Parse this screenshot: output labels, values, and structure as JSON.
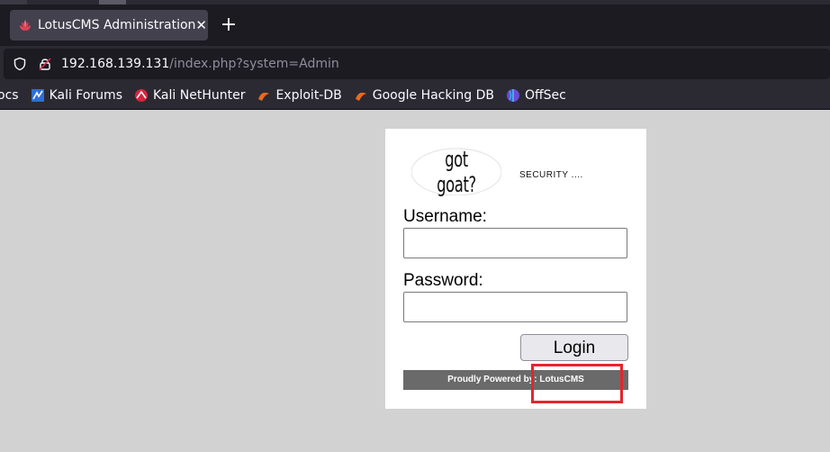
{
  "browser": {
    "tab": {
      "title": "LotusCMS Administration",
      "favicon": "lotus-icon",
      "close_glyph": "✕"
    },
    "new_tab_glyph": "+",
    "url": {
      "host": "192.168.139.131",
      "path": "/index.php?system=Admin"
    },
    "bookmarks": [
      {
        "label": "ocs",
        "icon": ""
      },
      {
        "label": "Kali Forums",
        "icon": "kali-forums-icon"
      },
      {
        "label": "Kali NetHunter",
        "icon": "kali-nethunter-icon"
      },
      {
        "label": "Exploit-DB",
        "icon": "exploit-db-icon"
      },
      {
        "label": "Google Hacking DB",
        "icon": "ghdb-icon"
      },
      {
        "label": "OffSec",
        "icon": "offsec-icon"
      }
    ]
  },
  "login": {
    "logo_text": "got goat?",
    "tagline": "SECURITY ....",
    "username_label": "Username:",
    "username_value": "",
    "password_label": "Password:",
    "password_value": "",
    "login_button": "Login",
    "footer": "Proudly Powered by: LotusCMS"
  },
  "colors": {
    "page_bg": "#d2d2d2",
    "highlight": "#e3262d",
    "footer_bg": "#6a6a6a"
  }
}
